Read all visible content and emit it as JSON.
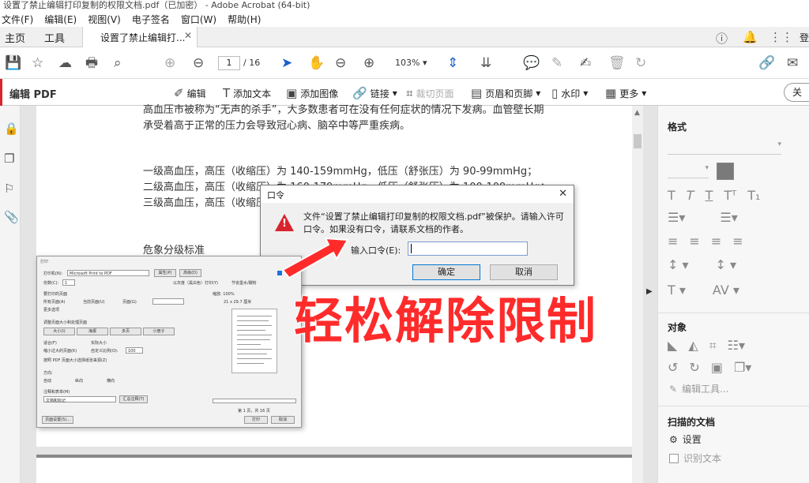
{
  "window": {
    "title": "设置了禁止编辑打印复制的权限文档.pdf（已加密） - Adobe Acrobat (64-bit)"
  },
  "menu": [
    "文件(F)",
    "编辑(E)",
    "视图(V)",
    "电子签名",
    "窗口(W)",
    "帮助(H)"
  ],
  "tabs": {
    "home": "主页",
    "tools": "工具",
    "doc": "设置了禁止编辑打...",
    "login": "登"
  },
  "toolbar": {
    "page_current": "1",
    "page_total": "/ 16",
    "zoom": "103%"
  },
  "editbar": {
    "title": "编辑 PDF",
    "items": [
      "编辑",
      "添加文本",
      "添加图像",
      "链接",
      "裁切页面",
      "页眉和页脚",
      "水印",
      "更多"
    ],
    "close": "关"
  },
  "document": {
    "lines": [
      "高血压市被称为“无声的杀手”，大多数患者可在没有任何症状的情况下发病。血管壁长期",
      "承受着高于正常的压力会导致冠心病、脑卒中等严重疾病。",
      "一级高血压，高压（收缩压）为 140-159mmHg，低压（舒张压）为 90-99mmHg；",
      "二级高血压，高压（收缩压）为 160-179mmHg，低压（舒张压）为 100-109mmHg；",
      "三级高血压，高压（收缩压）",
      "危象分级标准"
    ]
  },
  "right_panel": {
    "format": "格式",
    "object": "对象",
    "edit_tools": "编辑工具...",
    "scanned": "扫描的文档",
    "settings": "设置",
    "recognize": "识别文本"
  },
  "password_dialog": {
    "title": "口令",
    "message": "文件“设置了禁止编辑打印复制的权限文档.pdf”被保护。请输入许可口令。如果没有口令，请联系文档的作者。",
    "label": "输入口令(E):",
    "ok": "确定",
    "cancel": "取消"
  },
  "print_dialog": {
    "title": "打印",
    "printer_label": "打印机(N):",
    "printer": "Microsoft Print to PDF",
    "properties": "属性(P)",
    "advanced": "高级(D)",
    "copies": "份数(C):",
    "copies_value": "1",
    "grayscale": "以灰度（黑白色）打印(Y)",
    "save_ink": "节省墨水/碳粉",
    "pages_header": "要打印的页面",
    "all": "所有页面(A)",
    "current": "当前页面(U)",
    "pages": "页面(G)",
    "more": "更多选项",
    "size_header": "调整页面大小和处理页面",
    "size_buttons": [
      "大小(I)",
      "海报",
      "多页",
      "小册子"
    ],
    "fit": "适合(F)",
    "actual": "实际大小",
    "shrink": "缩小过大的页面(K)",
    "custom": "自定义比例(O):",
    "scale": "100",
    "choose_paper": "按照 PDF 页面大小选择纸张来源(Z)",
    "orientation": "方向:",
    "auto": "自动",
    "portrait": "纵向",
    "landscape": "横向",
    "comments": "注释和表单(M)",
    "comments_value": "文档和标记",
    "summarize": "汇总注释(T)",
    "zoom": "缩放: 100%",
    "size": "21 x 29.7 厘米",
    "page_of": "第 1 页，共 16 页",
    "page_setup": "页面设置(S)...",
    "print": "打印",
    "cancel": "取消"
  },
  "annotation": {
    "text": "轻松解除限制",
    "color": "#ff2b2b"
  },
  "colors": {
    "accent": "#d8242d",
    "dialog_button_border": "#0078d7"
  }
}
